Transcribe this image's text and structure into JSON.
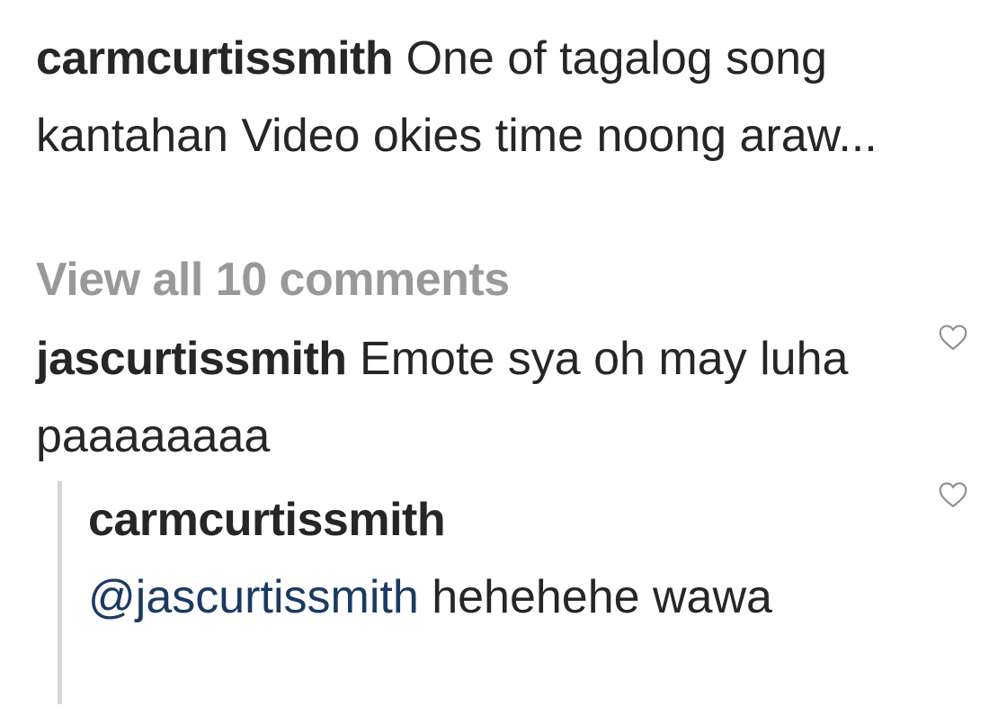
{
  "caption": {
    "username": "carmcurtissmith",
    "text": "One of tagalog song kantahan Video okies time noong araw..."
  },
  "view_all_comments": "View all 10 comments",
  "comments": [
    {
      "username": "jascurtissmith",
      "text": "Emote sya oh may luha paaaaaaaa",
      "like_icon": "heart-outline-icon",
      "replies": [
        {
          "username": "carmcurtissmith",
          "mention": "@jascurtissmith",
          "text": "hehehehe wawa",
          "like_icon": "heart-outline-icon"
        }
      ]
    }
  ],
  "colors": {
    "text": "#262626",
    "muted": "#999999",
    "mention": "#1a3a63",
    "thread_line": "#d6d6d6"
  }
}
